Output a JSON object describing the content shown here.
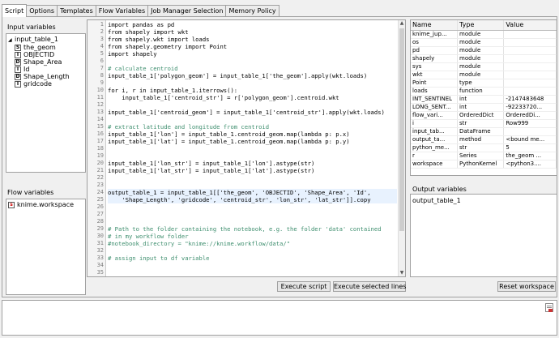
{
  "tabs": [
    "Script",
    "Options",
    "Templates",
    "Flow Variables",
    "Job Manager Selection",
    "Memory Policy"
  ],
  "input_variables": {
    "title": "Input variables",
    "table_name": "input_table_1",
    "columns": [
      {
        "type": "S",
        "name": "the_geom"
      },
      {
        "type": "I",
        "name": "OBJECTID"
      },
      {
        "type": "D",
        "name": "Shape_Area"
      },
      {
        "type": "I",
        "name": "Id"
      },
      {
        "type": "D",
        "name": "Shape_Length"
      },
      {
        "type": "I",
        "name": "gridcode"
      }
    ]
  },
  "flow_variables": {
    "title": "Flow variables",
    "items": [
      {
        "type": "s",
        "name": "knime.workspace"
      }
    ]
  },
  "code": {
    "line_numbers": [
      "1",
      "2",
      "3",
      "4",
      "5",
      "6",
      "7",
      "8",
      "9",
      "10",
      "11",
      "12",
      "13",
      "14",
      "15",
      "16",
      "17",
      "18",
      "19",
      "20",
      "21",
      "22",
      "23",
      "24",
      "25",
      "26",
      "27",
      "28",
      "29",
      "30",
      "31",
      "32",
      "33",
      "34",
      "35"
    ],
    "lines": [
      "import pandas as pd",
      "from shapely import wkt",
      "from shapely.wkt import loads",
      "from shapely.geometry import Point",
      "import shapely",
      "",
      "# calculate centroid",
      "input_table_1['polygon_geom'] = input_table_1['the_geom'].apply(wkt.loads)",
      "",
      "for i, r in input_table_1.iterrows():",
      "    input_table_1['centroid_str'] = r['polygon_geom'].centroid.wkt",
      "",
      "input_table_1['centroid_geom'] = input_table_1['centroid_str'].apply(wkt.loads)",
      "",
      "# extract latitude and longitude from centroid",
      "input_table_1['lon'] = input_table_1.centroid_geom.map(lambda p: p.x)",
      "input_table_1['lat'] = input_table_1.centroid_geom.map(lambda p: p.y)",
      "",
      "",
      "input_table_1['lon_str'] = input_table_1['lon'].astype(str)",
      "input_table_1['lat_str'] = input_table_1['lat'].astype(str)",
      "",
      "",
      "output_table_1 = input_table_1[['the_geom', 'OBJECTID', 'Shape_Area', 'Id',",
      "    'Shape_Length', 'gridcode', 'centroid_str', 'lon_str', 'lat_str']].copy",
      "",
      "",
      "",
      "# Path to the folder containing the notebook, e.g. the folder 'data' contained",
      "# in my workflow folder",
      "#notebook_directory = \"knime://knime.workflow/data/\"",
      "",
      "# assign input to df variable",
      "",
      ""
    ]
  },
  "buttons": {
    "execute_script": "Execute script",
    "execute_selected": "Execute selected lines",
    "reset_workspace": "Reset workspace"
  },
  "workspace": {
    "columns": [
      "Name",
      "Type",
      "Value"
    ],
    "rows": [
      [
        "knime_jup...",
        "module",
        ""
      ],
      [
        "os",
        "module",
        ""
      ],
      [
        "pd",
        "module",
        ""
      ],
      [
        "shapely",
        "module",
        ""
      ],
      [
        "sys",
        "module",
        ""
      ],
      [
        "wkt",
        "module",
        ""
      ],
      [
        "Point",
        "type",
        ""
      ],
      [
        "loads",
        "function",
        ""
      ],
      [
        "INT_SENTINEL",
        "int",
        "-2147483648"
      ],
      [
        "LONG_SENT...",
        "int",
        "-92233720..."
      ],
      [
        "flow_vari...",
        "OrderedDict",
        "OrderedDi..."
      ],
      [
        "i",
        "str",
        "Row999"
      ],
      [
        "input_tab...",
        "DataFrame",
        ""
      ],
      [
        "output_ta...",
        "method",
        "<bound me..."
      ],
      [
        "python_me...",
        "str",
        "5"
      ],
      [
        "r",
        "Series",
        "the_geom ..."
      ],
      [
        "workspace",
        "PythonKernel",
        "<python3...."
      ]
    ]
  },
  "output_variables": {
    "title": "Output variables",
    "items": [
      "output_table_1"
    ]
  }
}
